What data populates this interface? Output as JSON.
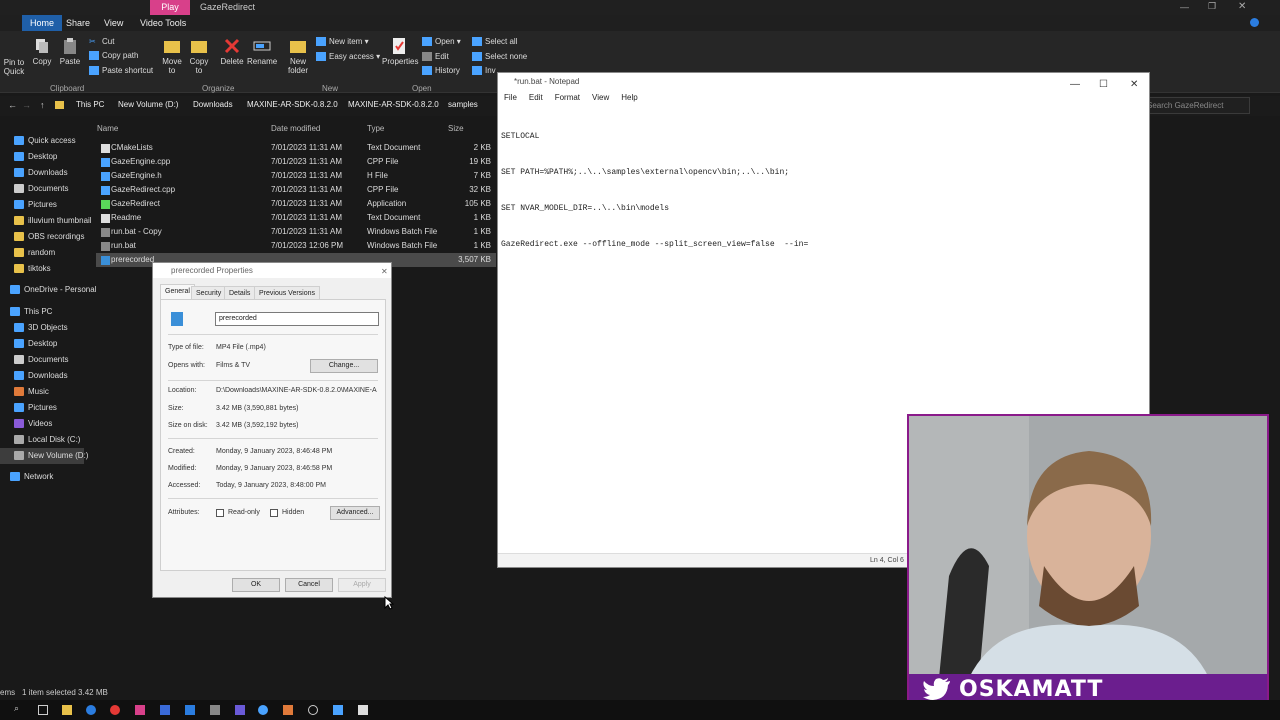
{
  "titlebar": {
    "play_tab": "Play",
    "title": "GazeRedirect"
  },
  "ribbon": {
    "tabs": [
      "Home",
      "Share",
      "View",
      "Video Tools"
    ],
    "clipboard": {
      "quick_access": "Pin to Quick access",
      "copy": "Copy",
      "paste": "Paste",
      "cut": "Cut",
      "copy_path": "Copy path",
      "paste_shortcut": "Paste shortcut",
      "group": "Clipboard"
    },
    "organize": {
      "move_to": "Move to",
      "copy_to": "Copy to",
      "delete": "Delete",
      "rename": "Rename",
      "group": "Organize"
    },
    "new": {
      "new_folder": "New folder",
      "new_item": "New item",
      "easy_access": "Easy access",
      "group": "New"
    },
    "open": {
      "properties": "Properties",
      "open": "Open",
      "edit": "Edit",
      "history": "History",
      "group": "Open"
    },
    "select": {
      "select_all": "Select all",
      "select_none": "Select none",
      "invert": "Invert selection"
    }
  },
  "address": {
    "crumbs": [
      "This PC",
      "New Volume (D:)",
      "Downloads",
      "MAXINE-AR-SDK-0.8.2.0",
      "MAXINE-AR-SDK-0.8.2.0",
      "samples"
    ],
    "search_placeholder": "Search GazeRedirect"
  },
  "sidebar": {
    "items": [
      {
        "label": "Quick access",
        "color": "#4aa3ff"
      },
      {
        "label": "Desktop",
        "color": "#4aa3ff"
      },
      {
        "label": "Downloads",
        "color": "#4aa3ff"
      },
      {
        "label": "Documents",
        "color": "#cccccc"
      },
      {
        "label": "Pictures",
        "color": "#4aa3ff"
      },
      {
        "label": "illuvium thumbnail",
        "color": "#e8c14a"
      },
      {
        "label": "OBS recordings",
        "color": "#e8c14a"
      },
      {
        "label": "random",
        "color": "#e8c14a"
      },
      {
        "label": "tiktoks",
        "color": "#e8c14a"
      },
      {
        "label": "OneDrive - Personal",
        "color": "#4aa3ff"
      },
      {
        "label": "This PC",
        "color": "#4aa3ff"
      },
      {
        "label": "3D Objects",
        "color": "#4aa3ff"
      },
      {
        "label": "Desktop",
        "color": "#4aa3ff"
      },
      {
        "label": "Documents",
        "color": "#cccccc"
      },
      {
        "label": "Downloads",
        "color": "#4aa3ff"
      },
      {
        "label": "Music",
        "color": "#e07a3a"
      },
      {
        "label": "Pictures",
        "color": "#4aa3ff"
      },
      {
        "label": "Videos",
        "color": "#8a5ad8"
      },
      {
        "label": "Local Disk (C:)",
        "color": "#aaaaaa"
      },
      {
        "label": "New Volume (D:)",
        "color": "#aaaaaa"
      },
      {
        "label": "Network",
        "color": "#4aa3ff"
      }
    ]
  },
  "files": {
    "headers": [
      "Name",
      "Date modified",
      "Type",
      "Size"
    ],
    "rows": [
      {
        "name": "CMakeLists",
        "date": "7/01/2023 11:31 AM",
        "type": "Text Document",
        "size": "2 KB"
      },
      {
        "name": "GazeEngine.cpp",
        "date": "7/01/2023 11:31 AM",
        "type": "CPP File",
        "size": "19 KB"
      },
      {
        "name": "GazeEngine.h",
        "date": "7/01/2023 11:31 AM",
        "type": "H File",
        "size": "7 KB"
      },
      {
        "name": "GazeRedirect.cpp",
        "date": "7/01/2023 11:31 AM",
        "type": "CPP File",
        "size": "32 KB"
      },
      {
        "name": "GazeRedirect",
        "date": "7/01/2023 11:31 AM",
        "type": "Application",
        "size": "105 KB"
      },
      {
        "name": "Readme",
        "date": "7/01/2023 11:31 AM",
        "type": "Text Document",
        "size": "1 KB"
      },
      {
        "name": "run.bat - Copy",
        "date": "7/01/2023 11:31 AM",
        "type": "Windows Batch File",
        "size": "1 KB"
      },
      {
        "name": "run.bat",
        "date": "7/01/2023 12:06 PM",
        "type": "Windows Batch File",
        "size": "1 KB"
      },
      {
        "name": "prerecorded",
        "date": "",
        "type": "",
        "size": "3,507 KB"
      }
    ]
  },
  "statusbar": {
    "items": "ems",
    "selected": "1 item selected 3.42 MB"
  },
  "notepad": {
    "title": "*run.bat - Notepad",
    "menu": [
      "File",
      "Edit",
      "Format",
      "View",
      "Help"
    ],
    "lines": [
      "SETLOCAL",
      "SET PATH=%PATH%;..\\..\\samples\\external\\opencv\\bin;..\\..\\bin;",
      "SET NVAR_MODEL_DIR=..\\..\\bin\\models",
      "GazeRedirect.exe --offline_mode --split_screen_view=false  --in="
    ],
    "status": "Ln 4, Col 6"
  },
  "properties": {
    "title": "prerecorded Properties",
    "tabs": [
      "General",
      "Security",
      "Details",
      "Previous Versions"
    ],
    "filename": "prerecorded",
    "type_label": "Type of file:",
    "type_value": "MP4 File (.mp4)",
    "opens_label": "Opens with:",
    "opens_value": "Films & TV",
    "change": "Change...",
    "location_label": "Location:",
    "location_value": "D:\\Downloads\\MAXINE-AR-SDK-0.8.2.0\\MAXINE-A",
    "size_label": "Size:",
    "size_value": "3.42 MB (3,590,881 bytes)",
    "disk_label": "Size on disk:",
    "disk_value": "3.42 MB (3,592,192 bytes)",
    "created_label": "Created:",
    "created_value": "Monday, 9 January 2023, 8:46:48 PM",
    "modified_label": "Modified:",
    "modified_value": "Monday, 9 January 2023, 8:46:58 PM",
    "accessed_label": "Accessed:",
    "accessed_value": "Today, 9 January 2023, 8:48:00 PM",
    "attributes_label": "Attributes:",
    "readonly": "Read-only",
    "hidden": "Hidden",
    "advanced": "Advanced...",
    "ok": "OK",
    "cancel": "Cancel",
    "apply": "Apply"
  },
  "webcam": {
    "handle": "OSKAMATT",
    "banner_color": "#6b1e8e"
  }
}
